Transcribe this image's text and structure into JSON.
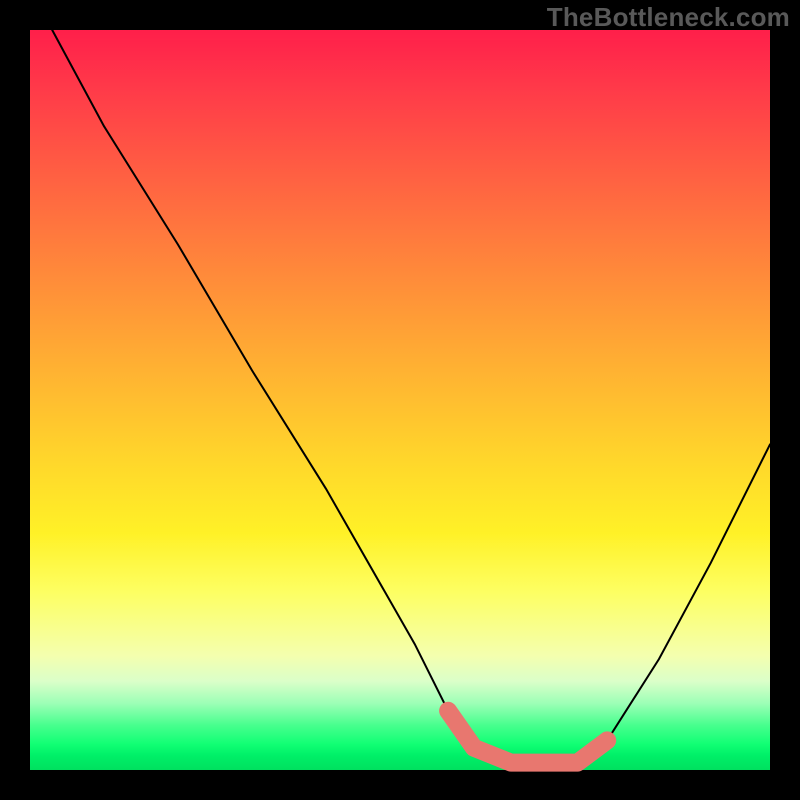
{
  "watermark": "TheBottleneck.com",
  "chart_data": {
    "type": "line",
    "title": "",
    "xlabel": "",
    "ylabel": "",
    "xlim": [
      0,
      100
    ],
    "ylim": [
      0,
      100
    ],
    "series": [
      {
        "name": "curve",
        "x": [
          3,
          10,
          20,
          30,
          40,
          48,
          52,
          56.5,
          60,
          65,
          70,
          74,
          78,
          85,
          92,
          100
        ],
        "values": [
          100,
          87,
          71,
          54,
          38,
          24,
          17,
          8,
          3,
          1,
          1,
          1,
          4,
          15,
          28,
          44
        ]
      }
    ],
    "highlight_segment": {
      "x": [
        56.5,
        60,
        65,
        70,
        74,
        78
      ],
      "values": [
        8,
        3,
        1,
        1,
        1,
        4
      ]
    },
    "gradient_stops": [
      {
        "pos": 0,
        "color": "#ff1f4a"
      },
      {
        "pos": 0.2,
        "color": "#ff6142"
      },
      {
        "pos": 0.46,
        "color": "#ffb232"
      },
      {
        "pos": 0.68,
        "color": "#fff127"
      },
      {
        "pos": 0.88,
        "color": "#dbffc9"
      },
      {
        "pos": 1.0,
        "color": "#00e05f"
      }
    ]
  }
}
